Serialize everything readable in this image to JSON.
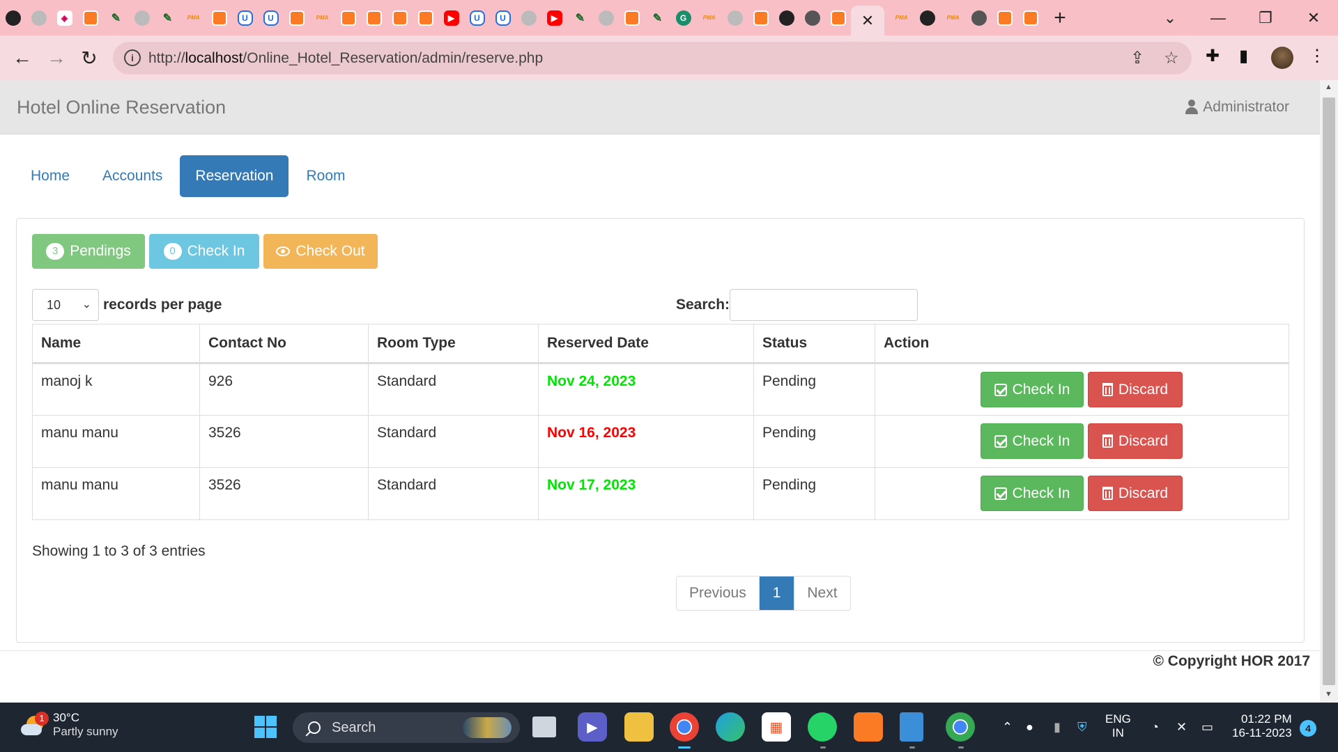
{
  "browser": {
    "tabs": [
      {
        "icon": "github-icon",
        "kind": "gh"
      },
      {
        "icon": "grey-globe-icon",
        "kind": "grey"
      },
      {
        "icon": "diamond-icon",
        "kind": "pk"
      },
      {
        "icon": "xampp-icon",
        "kind": "xampp"
      },
      {
        "icon": "feather-icon",
        "kind": "feather"
      },
      {
        "icon": "grey-globe-icon",
        "kind": "grey"
      },
      {
        "icon": "feather-icon",
        "kind": "feather"
      },
      {
        "icon": "phpmyadmin-icon",
        "kind": "pma"
      },
      {
        "icon": "xampp-icon",
        "kind": "xampp"
      },
      {
        "icon": "shield-icon",
        "kind": "shield"
      },
      {
        "icon": "shield-icon",
        "kind": "shield"
      },
      {
        "icon": "xampp-icon",
        "kind": "xampp"
      },
      {
        "icon": "phpmyadmin-icon",
        "kind": "pma"
      },
      {
        "icon": "xampp-icon",
        "kind": "xampp"
      },
      {
        "icon": "xampp-icon",
        "kind": "xampp"
      },
      {
        "icon": "xampp-icon",
        "kind": "xampp"
      },
      {
        "icon": "xampp-icon",
        "kind": "xampp"
      },
      {
        "icon": "youtube-icon",
        "kind": "yt"
      },
      {
        "icon": "shield-icon",
        "kind": "shield"
      },
      {
        "icon": "shield-icon",
        "kind": "shield"
      },
      {
        "icon": "xampp-icon",
        "kind": "grey"
      },
      {
        "icon": "youtube-icon",
        "kind": "yt"
      },
      {
        "icon": "feather-icon",
        "kind": "feather"
      },
      {
        "icon": "grey-globe-icon",
        "kind": "grey"
      },
      {
        "icon": "xampp-icon",
        "kind": "xampp"
      },
      {
        "icon": "feather-icon",
        "kind": "feather"
      },
      {
        "icon": "grammarly-icon",
        "kind": "g"
      },
      {
        "icon": "phpmyadmin-icon",
        "kind": "pma"
      },
      {
        "icon": "grey-globe-icon",
        "kind": "grey"
      },
      {
        "icon": "xampp-icon",
        "kind": "xampp"
      },
      {
        "icon": "github-icon",
        "kind": "gh"
      },
      {
        "icon": "chrome-icon",
        "kind": "chr"
      },
      {
        "icon": "xampp-icon",
        "kind": "xampp"
      }
    ],
    "active_tab_close": "✕",
    "tabs_after": [
      {
        "icon": "phpmyadmin-icon",
        "kind": "pma"
      },
      {
        "icon": "github-icon",
        "kind": "gh"
      },
      {
        "icon": "phpmyadmin-icon",
        "kind": "pma"
      },
      {
        "icon": "chrome-icon",
        "kind": "chr"
      },
      {
        "icon": "xampp-icon",
        "kind": "xampp"
      },
      {
        "icon": "xampp-icon",
        "kind": "xampp"
      }
    ],
    "new_tab": "+",
    "url": "http://localhost/Online_Hotel_Reservation/admin/reserve.php",
    "url_host": "localhost",
    "url_path": "/Online_Hotel_Reservation/admin/reserve.php",
    "url_scheme": "http://"
  },
  "app": {
    "brand": "Hotel Online Reservation",
    "user": "Administrator",
    "nav": [
      {
        "label": "Home",
        "active": false
      },
      {
        "label": "Accounts",
        "active": false
      },
      {
        "label": "Reservation",
        "active": true
      },
      {
        "label": "Room",
        "active": false
      }
    ],
    "filters": {
      "pendings": {
        "count": "3",
        "label": "Pendings"
      },
      "checkin": {
        "count": "0",
        "label": "Check In"
      },
      "checkout": {
        "label": "Check Out"
      }
    },
    "length": {
      "value": "10",
      "label": "records per page"
    },
    "search": {
      "label": "Search:",
      "value": ""
    },
    "table": {
      "headers": [
        "Name",
        "Contact No",
        "Room Type",
        "Reserved Date",
        "Status",
        "Action"
      ],
      "rows": [
        {
          "name": "manoj k",
          "contact": "926",
          "room_type": "Standard",
          "date": "Nov 24, 2023",
          "date_color": "#00e600",
          "status": "Pending"
        },
        {
          "name": "manu manu",
          "contact": "3526",
          "room_type": "Standard",
          "date": "Nov 16, 2023",
          "date_color": "#ff0000",
          "status": "Pending"
        },
        {
          "name": "manu manu",
          "contact": "3526",
          "room_type": "Standard",
          "date": "Nov 17, 2023",
          "date_color": "#00e600",
          "status": "Pending"
        }
      ],
      "action_checkin": "Check In",
      "action_discard": "Discard"
    },
    "info": "Showing 1 to 3 of 3 entries",
    "pagination": {
      "previous": "Previous",
      "current": "1",
      "next": "Next"
    },
    "copyright": "© Copyright HOR 2017"
  },
  "taskbar": {
    "weather_badge": "1",
    "temp": "30°C",
    "desc": "Partly sunny",
    "search": "Search",
    "lang_top": "ENG",
    "lang_bottom": "IN",
    "time": "01:22 PM",
    "date": "16-11-2023",
    "notifications": "4"
  },
  "colors": {
    "primary": "#337ab7",
    "success": "#5cb85c",
    "danger": "#d9534f",
    "tabstrip": "#f8bfc6"
  }
}
